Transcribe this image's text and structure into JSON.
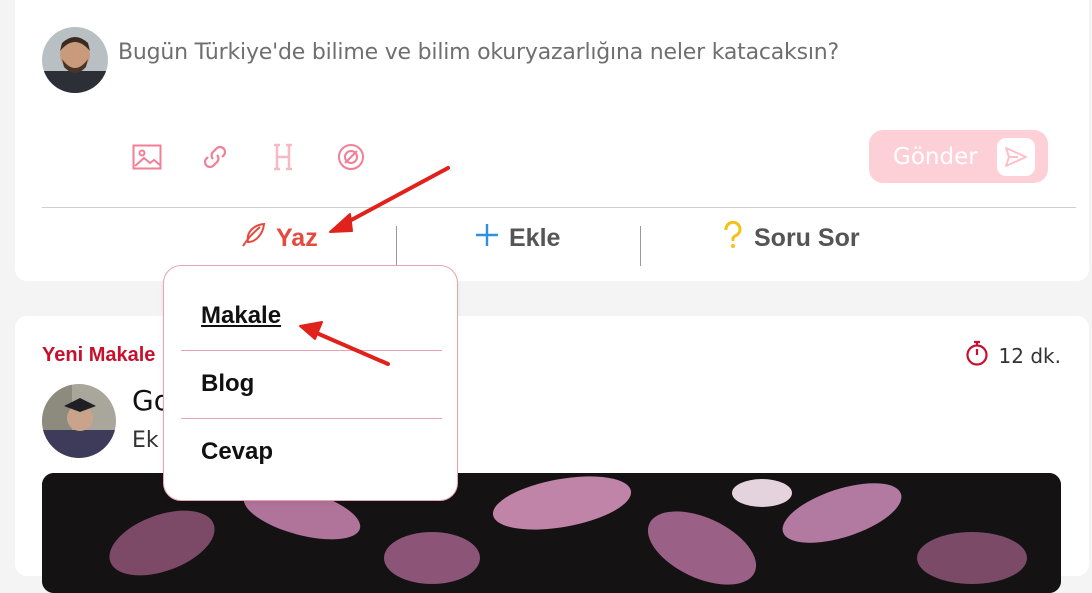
{
  "composer": {
    "prompt_placeholder": "Bugün Türkiye'de bilime ve bilim okuryazarlığına neler katacaksın?",
    "tools": [
      "image-icon",
      "link-icon",
      "heading-icon",
      "target-icon"
    ],
    "send_label": "Gönder",
    "actions": {
      "write_label": "Yaz",
      "add_label": "Ekle",
      "ask_label": "Soru Sor"
    }
  },
  "dropdown": {
    "items": [
      "Makale",
      "Blog",
      "Cevap"
    ]
  },
  "feed": {
    "badge": "Yeni Makale",
    "read_time": "12 dk.",
    "author_name_partial": "Go",
    "author_sub_partial": "Ek"
  },
  "colors": {
    "brand_red": "#c8102e",
    "write_red": "#e34b3f",
    "add_blue": "#2f8fe0",
    "ask_yellow": "#f2c21a",
    "send_disabled": "#fdd0d8",
    "tool_pink": "#f07f97",
    "arrow_red": "#e0211c"
  }
}
